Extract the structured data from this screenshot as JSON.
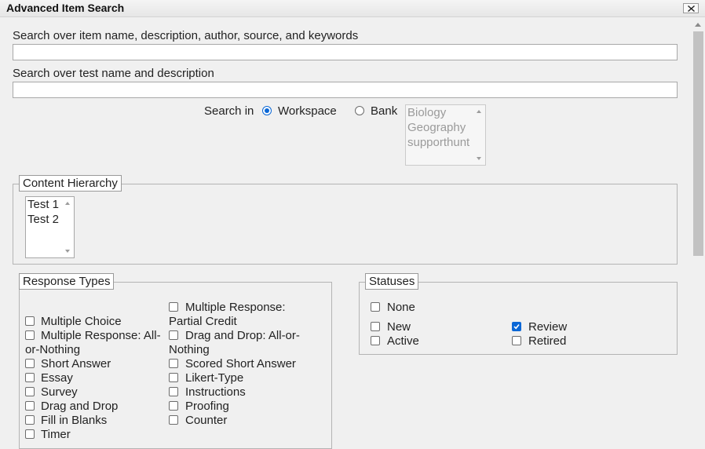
{
  "dialog": {
    "title": "Advanced Item Search"
  },
  "search": {
    "item_label": "Search over item name, description, author, source, and keywords",
    "item_value": "",
    "test_label": "Search over test name and description",
    "test_value": "",
    "search_in_label": "Search in",
    "workspace_label": "Workspace",
    "bank_label": "Bank",
    "selected": "Workspace",
    "banks": [
      "Biology",
      "Geography",
      "supporthunt"
    ]
  },
  "content_hierarchy": {
    "legend": "Content Hierarchy",
    "items": [
      "Test 1",
      "Test 2"
    ]
  },
  "response_types": {
    "legend": "Response Types",
    "left": [
      {
        "label": "Multiple Choice",
        "checked": false
      },
      {
        "label": "Multiple Response: All-",
        "label2": "or-Nothing",
        "checked": false
      },
      {
        "label": "Short Answer",
        "checked": false
      },
      {
        "label": "Essay",
        "checked": false
      },
      {
        "label": "Survey",
        "checked": false
      },
      {
        "label": "Drag and Drop",
        "checked": false
      },
      {
        "label": "Fill in Blanks",
        "checked": false
      },
      {
        "label": "Timer",
        "checked": false
      }
    ],
    "right": [
      {
        "label": "Multiple Response:",
        "label2": "Partial Credit",
        "checked": false
      },
      {
        "label": "Drag and Drop: All-or-",
        "label2": "Nothing",
        "checked": false
      },
      {
        "label": "Scored Short Answer",
        "checked": false
      },
      {
        "label": "Likert-Type",
        "checked": false
      },
      {
        "label": "Instructions",
        "checked": false
      },
      {
        "label": "Proofing",
        "checked": false
      },
      {
        "label": "Counter",
        "checked": false
      }
    ]
  },
  "statuses": {
    "legend": "Statuses",
    "none": {
      "label": "None",
      "checked": false
    },
    "items": [
      {
        "label": "New",
        "checked": false
      },
      {
        "label": "Review",
        "checked": true
      },
      {
        "label": "Active",
        "checked": false
      },
      {
        "label": "Retired",
        "checked": false
      }
    ]
  },
  "colors": {
    "accent": "#0a67d6",
    "background": "#f0f0f0"
  }
}
